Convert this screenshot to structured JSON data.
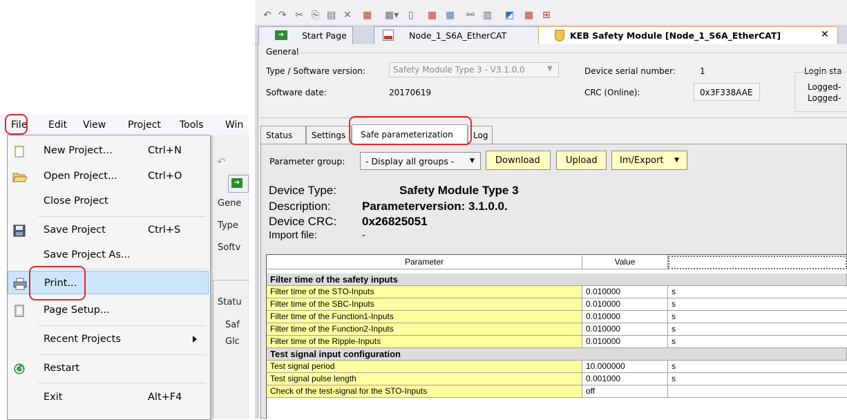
{
  "left_menubar": [
    "File",
    "Edit",
    "View",
    "Project",
    "Tools",
    "Win"
  ],
  "left_strip": [
    "Gene",
    "Type",
    "Softv",
    "Statu",
    "Saf",
    "Glc"
  ],
  "file_menu": [
    {
      "label": "New Project...",
      "shortcut": "Ctrl+N",
      "icon": "new-project-icon"
    },
    {
      "label": "Open Project...",
      "shortcut": "Ctrl+O",
      "icon": "open-folder-icon"
    },
    {
      "label": "Close Project",
      "shortcut": "",
      "icon": ""
    },
    {
      "label": "Save Project",
      "shortcut": "Ctrl+S",
      "icon": "save-disk-icon"
    },
    {
      "label": "Save Project As...",
      "shortcut": "",
      "icon": ""
    },
    {
      "label": "Print...",
      "shortcut": "",
      "icon": "printer-icon"
    },
    {
      "label": "Page Setup...",
      "shortcut": "",
      "icon": "page-setup-icon"
    },
    {
      "label": "Recent Projects",
      "shortcut": "",
      "icon": ""
    },
    {
      "label": "Restart",
      "shortcut": "",
      "icon": "restart-icon"
    },
    {
      "label": "Exit",
      "shortcut": "Alt+F4",
      "icon": ""
    }
  ],
  "doc_tabs": [
    {
      "label": "Start Page",
      "icon": "start-page-arrow-icon"
    },
    {
      "label": "Node_1_S6A_EtherCAT",
      "icon": "keb-device-icon"
    },
    {
      "label": "KEB Safety Module [Node_1_S6A_EtherCAT]",
      "icon": "safety-shield-icon",
      "close": "✕"
    }
  ],
  "general": {
    "section": "General",
    "type_label": "Type / Software version:",
    "type_value": "Safety Module Type 3 - V3.1.0.0",
    "serial_label": "Device serial number:",
    "serial_value": "1",
    "login_label": "Login sta",
    "date_label": "Software date:",
    "date_value": "20170619",
    "crc_label": "CRC (Online):",
    "crc_value": "0x3F338AAE",
    "logged_1": "Logged-",
    "logged_2": "Logged-"
  },
  "sub_tabs": [
    "Status",
    "Settings",
    "Safe parameterization",
    "Log"
  ],
  "toolbar": {
    "param_group_label": "Parameter group:",
    "param_group_value": "- Display all groups -",
    "download": "Download",
    "upload": "Upload",
    "imexport": "Im/Export"
  },
  "device_info": {
    "type_label": "Device Type:",
    "type_value": "Safety Module Type 3",
    "desc_label": "Description:",
    "desc_value": "Parameterversion: 3.1.0.0.",
    "crc_label": "Device CRC:",
    "crc_value": "0x26825051",
    "import_label": "Import file:",
    "import_value": "-"
  },
  "table": {
    "headers": [
      "Parameter",
      "Value"
    ],
    "rows": [
      {
        "kind": "grp",
        "name": "Filter time of the safety inputs"
      },
      {
        "kind": "data",
        "name": "Filter time of the STO-Inputs",
        "value": "0.010000",
        "unit": "s"
      },
      {
        "kind": "data",
        "name": "Filter time of the SBC-Inputs",
        "value": "0.010000",
        "unit": "s"
      },
      {
        "kind": "data",
        "name": "Filter time of the Function1-Inputs",
        "value": "0.010000",
        "unit": "s"
      },
      {
        "kind": "data",
        "name": "Filter time of the Function2-Inputs",
        "value": "0.010000",
        "unit": "s"
      },
      {
        "kind": "data",
        "name": "Filter time of the Ripple-Inputs",
        "value": "0.010000",
        "unit": "s"
      },
      {
        "kind": "grp",
        "name": "Test signal input configuration"
      },
      {
        "kind": "data",
        "name": "Test signal period",
        "value": "10.000000",
        "unit": "s"
      },
      {
        "kind": "data",
        "name": "Test signal pulse length",
        "value": "0.001000",
        "unit": "s"
      },
      {
        "kind": "data",
        "name": "Check of the test-signal for the STO-Inputs",
        "value": "off",
        "unit": ""
      }
    ]
  }
}
